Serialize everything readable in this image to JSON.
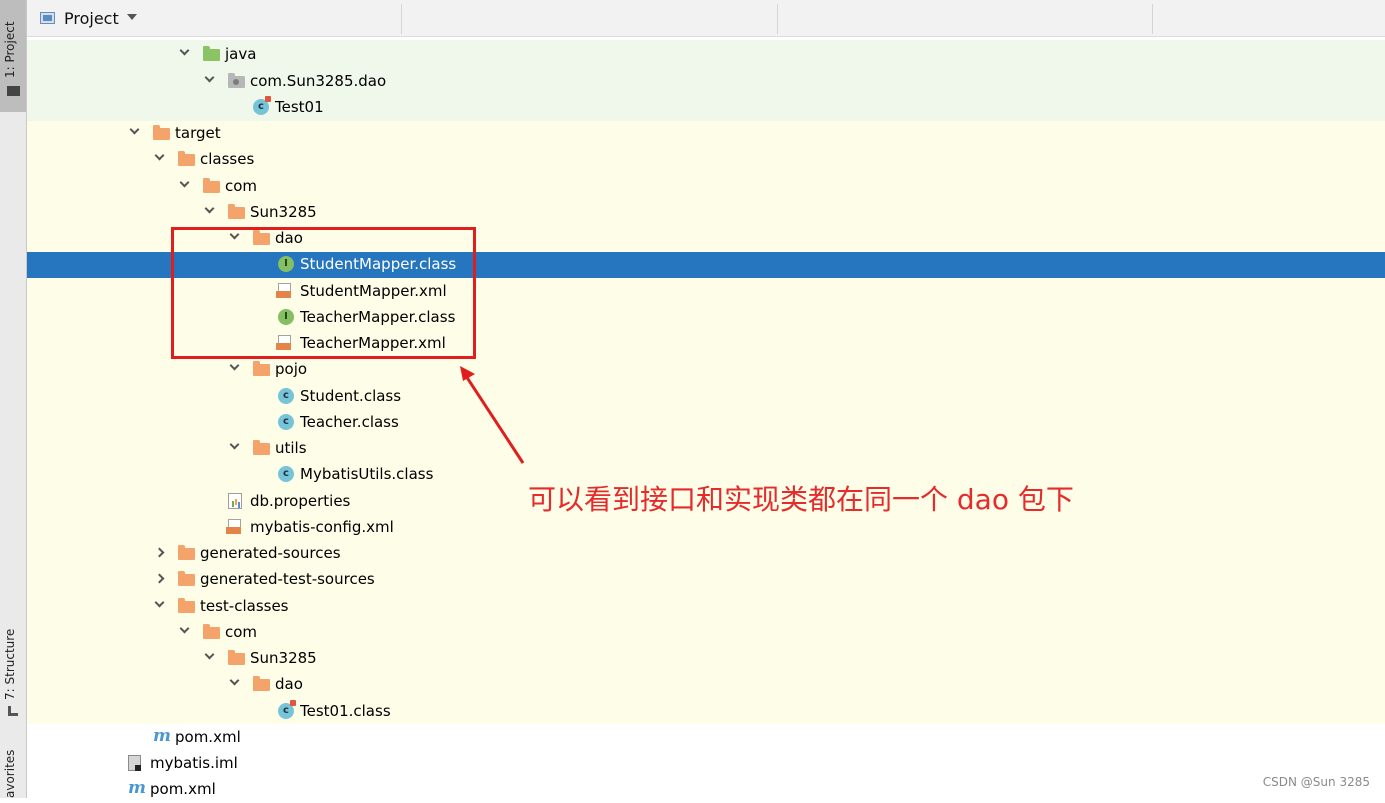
{
  "tool_window": {
    "title": "Project"
  },
  "side_tabs": {
    "project": "1: Project",
    "structure": "7: Structure",
    "favorites": "avorites"
  },
  "tree": [
    {
      "label": "java",
      "icon": "folder-green",
      "expanded": true,
      "selected": false
    },
    {
      "label": "com.Sun3285.dao",
      "icon": "package-folder",
      "expanded": true,
      "selected": false
    },
    {
      "label": "Test01",
      "icon": "test-class",
      "expanded": null,
      "selected": false
    },
    {
      "label": "target",
      "icon": "folder-orange",
      "expanded": true,
      "selected": false
    },
    {
      "label": "classes",
      "icon": "folder-orange",
      "expanded": true,
      "selected": false
    },
    {
      "label": "com",
      "icon": "folder-orange",
      "expanded": true,
      "selected": false
    },
    {
      "label": "Sun3285",
      "icon": "folder-orange",
      "expanded": true,
      "selected": false
    },
    {
      "label": "dao",
      "icon": "folder-orange",
      "expanded": true,
      "selected": false
    },
    {
      "label": "StudentMapper.class",
      "icon": "interface",
      "expanded": null,
      "selected": true
    },
    {
      "label": "StudentMapper.xml",
      "icon": "xml-file",
      "expanded": null,
      "selected": false
    },
    {
      "label": "TeacherMapper.class",
      "icon": "interface",
      "expanded": null,
      "selected": false
    },
    {
      "label": "TeacherMapper.xml",
      "icon": "xml-file",
      "expanded": null,
      "selected": false
    },
    {
      "label": "pojo",
      "icon": "folder-orange",
      "expanded": true,
      "selected": false
    },
    {
      "label": "Student.class",
      "icon": "class",
      "expanded": null,
      "selected": false
    },
    {
      "label": "Teacher.class",
      "icon": "class",
      "expanded": null,
      "selected": false
    },
    {
      "label": "utils",
      "icon": "folder-orange",
      "expanded": true,
      "selected": false
    },
    {
      "label": "MybatisUtils.class",
      "icon": "class",
      "expanded": null,
      "selected": false
    },
    {
      "label": "db.properties",
      "icon": "properties-file",
      "expanded": null,
      "selected": false
    },
    {
      "label": "mybatis-config.xml",
      "icon": "xml-file",
      "expanded": null,
      "selected": false
    },
    {
      "label": "generated-sources",
      "icon": "folder-orange",
      "expanded": false,
      "selected": false
    },
    {
      "label": "generated-test-sources",
      "icon": "folder-orange",
      "expanded": false,
      "selected": false
    },
    {
      "label": "test-classes",
      "icon": "folder-orange",
      "expanded": true,
      "selected": false
    },
    {
      "label": "com",
      "icon": "folder-orange",
      "expanded": true,
      "selected": false
    },
    {
      "label": "Sun3285",
      "icon": "folder-orange",
      "expanded": true,
      "selected": false
    },
    {
      "label": "dao",
      "icon": "folder-orange",
      "expanded": true,
      "selected": false
    },
    {
      "label": "Test01.class",
      "icon": "test-class",
      "expanded": null,
      "selected": false
    },
    {
      "label": "pom.xml",
      "icon": "maven-file",
      "expanded": null,
      "selected": false
    },
    {
      "label": "mybatis.iml",
      "icon": "iml-file",
      "expanded": null,
      "selected": false
    },
    {
      "label": "pom.xml",
      "icon": "maven-file",
      "expanded": null,
      "selected": false
    }
  ],
  "annotation": {
    "text": "可以看到接口和实现类都在同一个 dao 包下",
    "color": "#e01e1e"
  },
  "watermark": "CSDN @Sun 3285",
  "colors": {
    "selection": "#2675bf",
    "source_band": "#eff8ea",
    "excluded_band": "#fdfde8"
  }
}
